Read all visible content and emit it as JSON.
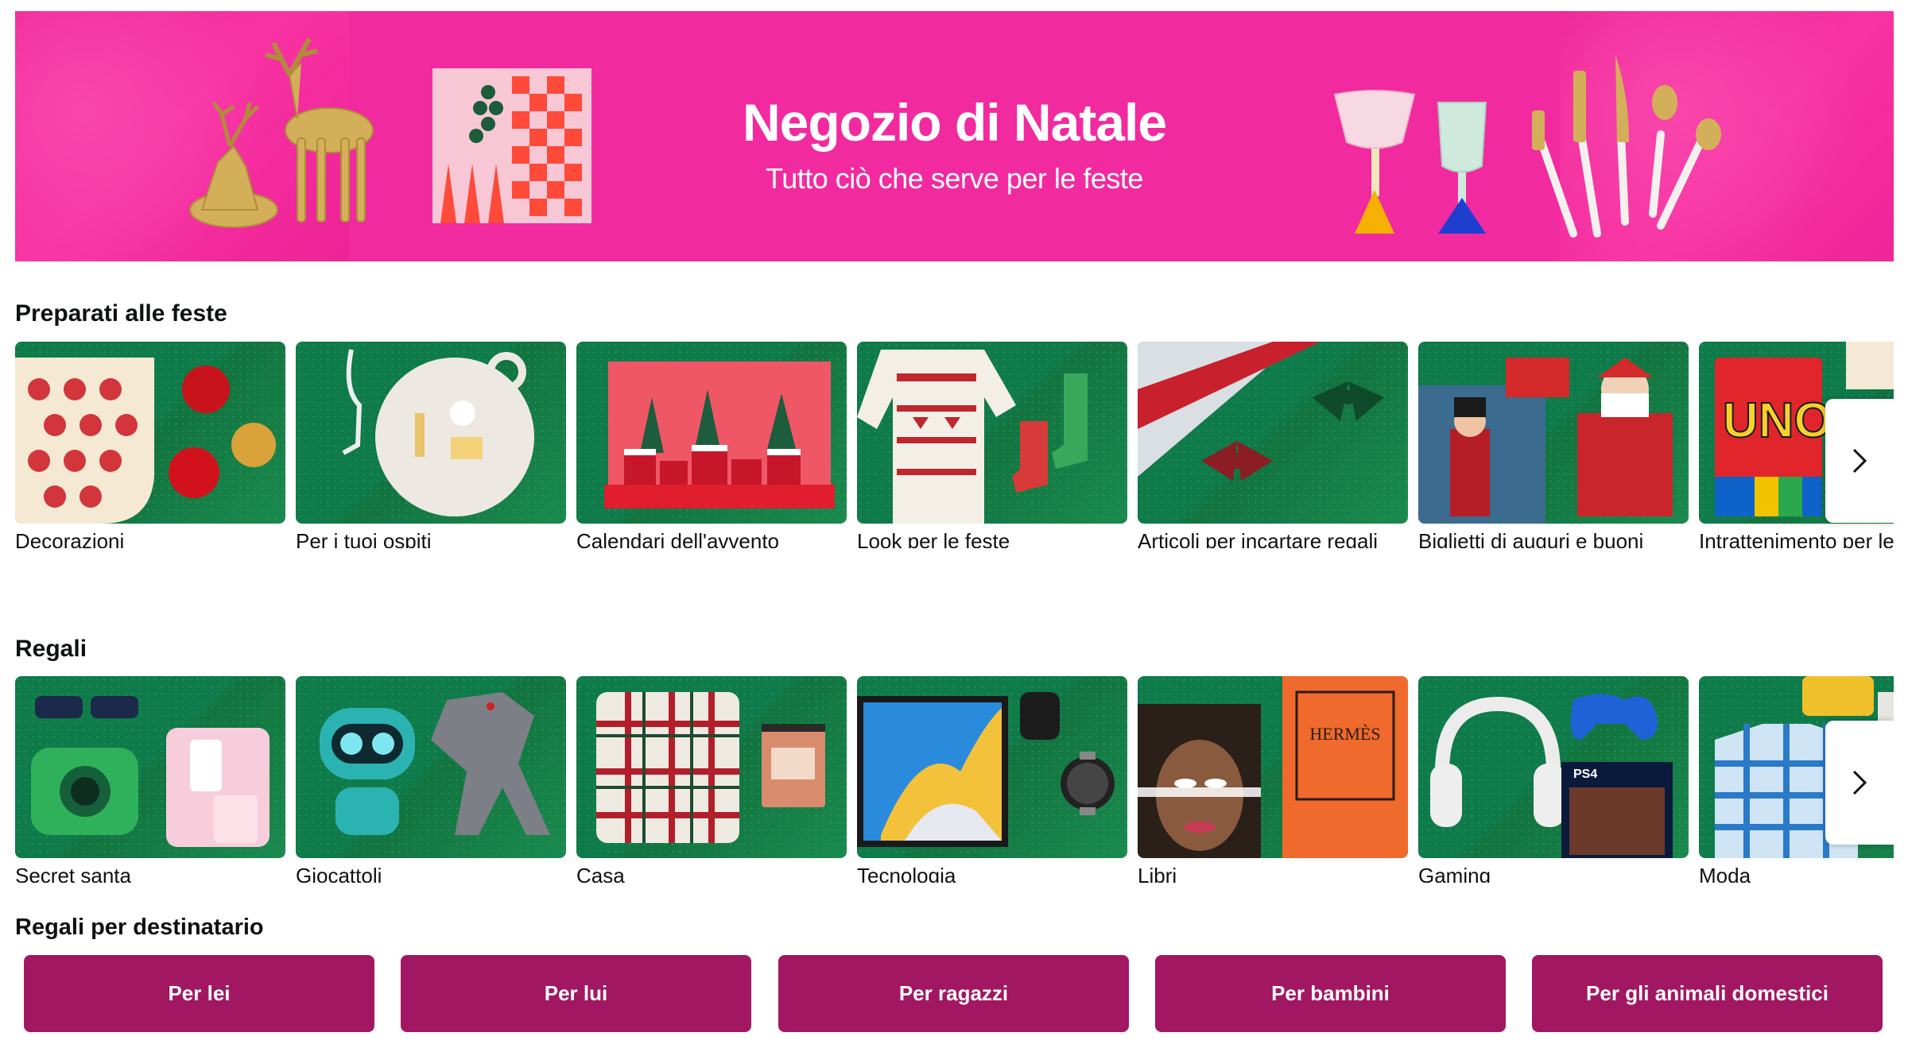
{
  "banner": {
    "title": "Negozio di Natale",
    "subtitle": "Tutto ciò che serve per le feste",
    "background_color": "#f22a9f"
  },
  "section1": {
    "title": "Preparati alle feste",
    "items": [
      {
        "label": "Decorazioni",
        "icon": "stocking-ornaments"
      },
      {
        "label": "Per i tuoi ospiti",
        "icon": "cheese-board"
      },
      {
        "label": "Calendari dell'avvento",
        "icon": "advent-village"
      },
      {
        "label": "Look per le feste",
        "icon": "christmas-sweater"
      },
      {
        "label": "Articoli per incartare regali",
        "icon": "gift-wrap-bows"
      },
      {
        "label": "Biglietti di auguri e buoni regalo",
        "icon": "greeting-cards"
      },
      {
        "label": "Intrattenimento per le",
        "icon": "uno-cards"
      }
    ],
    "next_icon": "chevron-right-icon"
  },
  "section2": {
    "title": "Regali",
    "items": [
      {
        "label": "Secret santa",
        "icon": "kids-camera"
      },
      {
        "label": "Giocattoli",
        "icon": "robot-dinosaur"
      },
      {
        "label": "Casa",
        "icon": "plaid-pillow"
      },
      {
        "label": "Tecnologia",
        "icon": "tablet-watch"
      },
      {
        "label": "Libri",
        "icon": "books"
      },
      {
        "label": "Gaming",
        "icon": "headphones-controller"
      },
      {
        "label": "Moda",
        "icon": "shirt-beanie"
      }
    ],
    "book_text": "HERMÈS",
    "game_text": "PS4",
    "uno_text": "UNO",
    "next_icon": "chevron-right-icon"
  },
  "section3": {
    "title": "Regali per destinatario",
    "buttons": [
      "Per lei",
      "Per lui",
      "Per ragazzi",
      "Per bambini",
      "Per gli animali domestici"
    ],
    "button_color": "#a21761"
  },
  "colors": {
    "card_green": "#0f7a4a",
    "text": "#0f1111"
  }
}
